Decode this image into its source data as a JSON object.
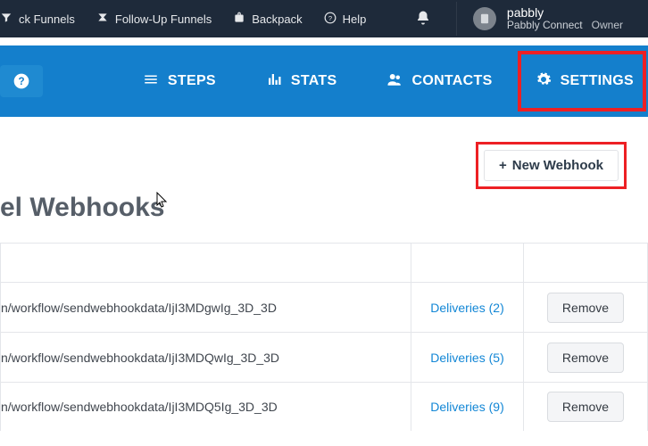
{
  "header": {
    "nav": [
      {
        "label": "ck Funnels",
        "icon": "funnel-icon"
      },
      {
        "label": "Follow-Up Funnels",
        "icon": "followup-icon"
      },
      {
        "label": "Backpack",
        "icon": "backpack-icon"
      },
      {
        "label": "Help",
        "icon": "help-icon"
      }
    ],
    "bell_icon": "bell-icon",
    "account": {
      "name": "pabbly",
      "product": "Pabbly Connect",
      "role": "Owner"
    }
  },
  "tabbar": {
    "help_icon": "question-icon",
    "tabs": [
      {
        "label": "STEPS",
        "icon": "steps-icon"
      },
      {
        "label": "STATS",
        "icon": "stats-icon"
      },
      {
        "label": "CONTACTS",
        "icon": "contacts-icon"
      },
      {
        "label": "SETTINGS",
        "icon": "settings-icon",
        "highlighted": true
      }
    ]
  },
  "content": {
    "new_webhook_label": "New Webhook",
    "page_title": "el Webhooks",
    "table": {
      "deliveries_word": "Deliveries",
      "remove_label": "Remove",
      "rows": [
        {
          "url": "n/workflow/sendwebhookdata/IjI3MDgwIg_3D_3D",
          "count": 2
        },
        {
          "url": "n/workflow/sendwebhookdata/IjI3MDQwIg_3D_3D",
          "count": 5
        },
        {
          "url": "n/workflow/sendwebhookdata/IjI3MDQ5Ig_3D_3D",
          "count": 9
        }
      ]
    }
  }
}
